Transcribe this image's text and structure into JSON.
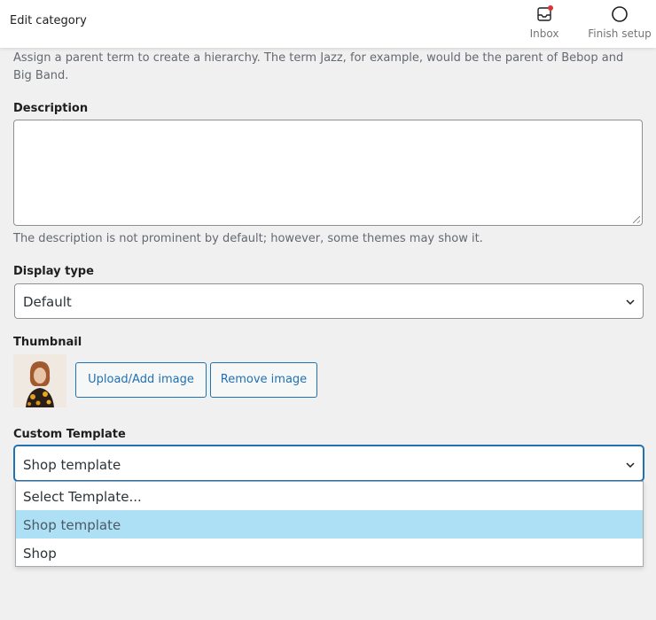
{
  "header": {
    "title": "Edit category",
    "inbox_label": "Inbox",
    "finish_label": "Finish setup"
  },
  "parent": {
    "help": "Assign a parent term to create a hierarchy. The term Jazz, for example, would be the parent of Bebop and Big Band."
  },
  "description": {
    "label": "Description",
    "value": "",
    "help": "The description is not prominent by default; however, some themes may show it."
  },
  "display_type": {
    "label": "Display type",
    "selected": "Default"
  },
  "thumbnail": {
    "label": "Thumbnail",
    "upload_label": "Upload/Add image",
    "remove_label": "Remove image"
  },
  "custom_template": {
    "label": "Custom Template",
    "selected": "Shop template",
    "options": [
      "Select Template...",
      "Shop template",
      "Shop"
    ],
    "highlighted_index": 1
  },
  "colors": {
    "accent": "#2271b1",
    "highlight": "#ade0f4",
    "notification": "#d63638",
    "background": "#f0f0f1"
  },
  "icons": {
    "inbox": "inbox-icon",
    "finish": "circle-icon",
    "chevron": "chevron-down-icon",
    "resize": "resize-grip-icon"
  }
}
